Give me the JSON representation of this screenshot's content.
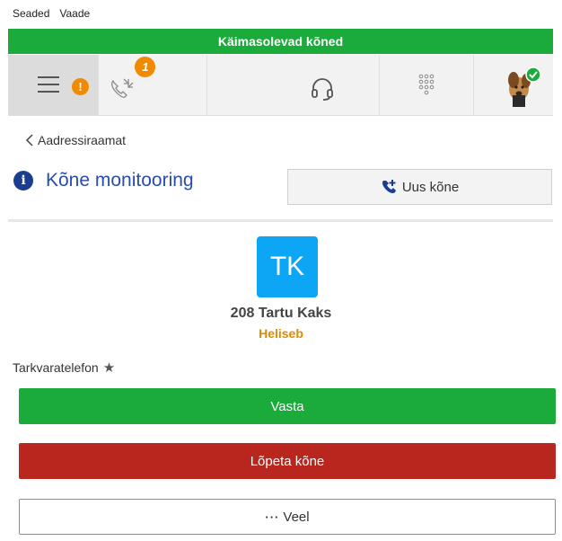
{
  "menubar": {
    "items": [
      "Seaded",
      "Vaade"
    ]
  },
  "banner": {
    "text": "Käimasolevad kõned"
  },
  "toolbar": {
    "warning_symbol": "!",
    "call_badge_count": "1",
    "icons": [
      "menu-icon",
      "warning-icon",
      "calls-transfer-icon",
      "headset-icon",
      "dialpad-icon",
      "avatar"
    ],
    "accent_color": "#f08a00"
  },
  "nav": {
    "back_label": "Aadressiraamat"
  },
  "header": {
    "title": "Kõne monitooring",
    "info_symbol": "i",
    "new_call_label": "Uus kõne"
  },
  "contact": {
    "initials": "TK",
    "name": "208 Tartu Kaks",
    "status": "Heliseb",
    "avatar_color": "#0da6f5",
    "status_color": "#e08a00"
  },
  "device": {
    "label": "Tarkvaratelefon",
    "star": "★"
  },
  "actions": {
    "answer": "Vasta",
    "hangup": "Lõpeta kõne",
    "more_dots": "···",
    "more": "Veel"
  },
  "colors": {
    "green": "#1aab3a",
    "red": "#b8261e",
    "title_blue": "#2a4cae"
  }
}
